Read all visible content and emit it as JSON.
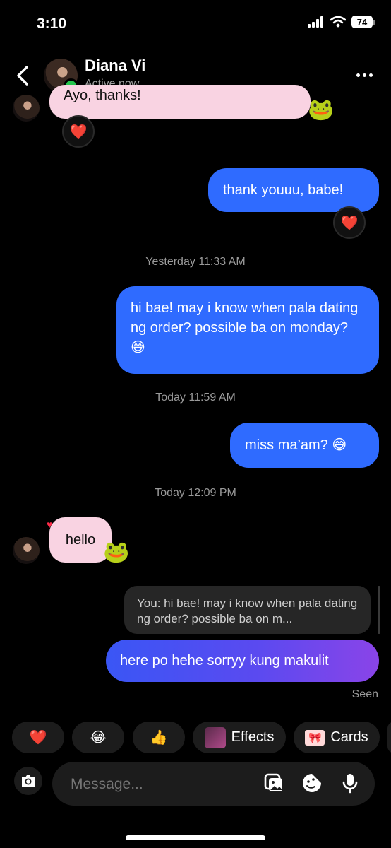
{
  "status": {
    "time": "3:10",
    "battery": "74"
  },
  "header": {
    "name": "Diana Vi",
    "status": "Active now"
  },
  "messages": {
    "partial_incoming": "Ayo, thanks!",
    "out1": "thank youuu, babe!",
    "stamp1": "Yesterday 11:33 AM",
    "out2": "hi bae! may i know when pala dating ng order? possible ba on monday? 😅",
    "stamp2": "Today 11:59 AM",
    "out3": "miss ma’am? 😅",
    "stamp3": "Today 12:09 PM",
    "in_hello": "hello",
    "reply_preview": "You: hi bae! may i know when pala dating ng order? possible ba on m...",
    "out4": "here po hehe sorryy kung makulit",
    "seen": "Seen",
    "reaction_emoji": "❤️",
    "sticker": "🐸"
  },
  "quick_reactions": {
    "heart": "❤️",
    "laugh": "😂",
    "thumbs": "👍",
    "effects": "Effects",
    "cards": "Cards"
  },
  "composer": {
    "placeholder": "Message..."
  },
  "colors": {
    "outgoing": "#2f6bff",
    "incoming": "#f9d3e2",
    "online": "#24c44d"
  },
  "icons": [
    "back-chevron-icon",
    "more-icon",
    "camera-icon",
    "gallery-icon",
    "sticker-icon",
    "mic-icon",
    "signal-icon",
    "wifi-icon"
  ]
}
